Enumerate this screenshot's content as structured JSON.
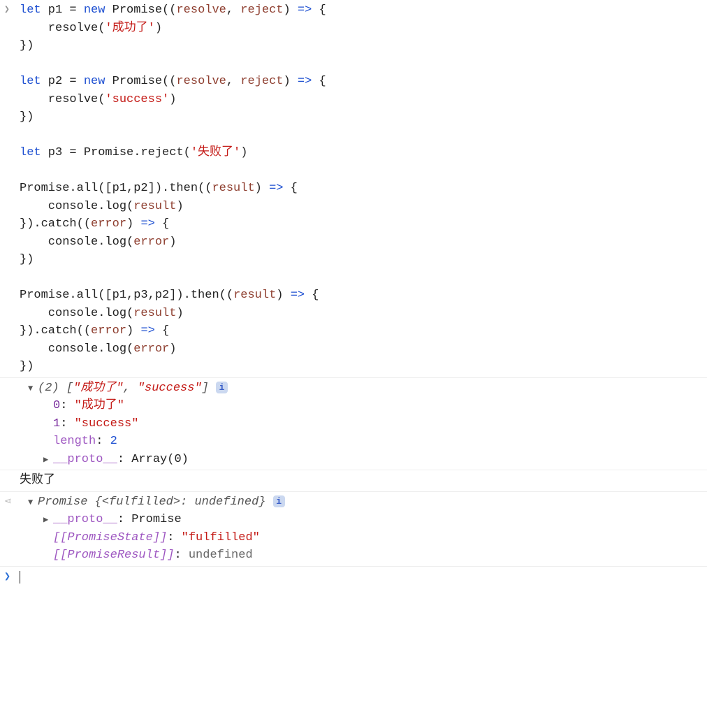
{
  "input_gutter": "❯",
  "return_gutter": "⋖",
  "prompt_gutter": "❯",
  "code": {
    "l1_let": "let",
    "l1_p1": " p1 ",
    "l1_eq": "= ",
    "l1_new": "new",
    "l1_prom": " Promise((",
    "l1_resolve": "resolve",
    "l1_c1": ", ",
    "l1_reject": "reject",
    "l1_c2": ") ",
    "l1_arrow": "=>",
    "l1_ob": " {",
    "l2_indent": "    resolve(",
    "l2_str": "'成功了'",
    "l2_close": ")",
    "l3": "})",
    "blank": "",
    "l5_let": "let",
    "l5_p2": " p2 ",
    "l5_eq": "= ",
    "l5_new": "new",
    "l5_prom": " Promise((",
    "l5_resolve": "resolve",
    "l5_c1": ", ",
    "l5_reject": "reject",
    "l5_c2": ") ",
    "l5_arrow": "=>",
    "l5_ob": " {",
    "l6_indent": "    resolve(",
    "l6_str": "'success'",
    "l6_close": ")",
    "l7": "})",
    "l9_let": "let",
    "l9_p3": " p3 ",
    "l9_eq": "= Promise.reject(",
    "l9_str": "'失败了'",
    "l9_close": ")",
    "l11_a": "Promise.all([p1,p2]).then((",
    "l11_result": "result",
    "l11_b": ") ",
    "l11_arrow": "=>",
    "l11_c": " {",
    "l12_a": "    console.log(",
    "l12_result": "result",
    "l12_b": ")",
    "l13_a": "}).catch((",
    "l13_error": "error",
    "l13_b": ") ",
    "l13_arrow": "=>",
    "l13_c": " {",
    "l14_a": "    console.log(",
    "l14_error": "error",
    "l14_b": ")",
    "l15": "})",
    "l17_a": "Promise.all([p1,p3,p2]).then((",
    "l17_result": "result",
    "l17_b": ") ",
    "l17_arrow": "=>",
    "l17_c": " {",
    "l18_a": "    console.log(",
    "l18_result": "result",
    "l18_b": ")",
    "l19_a": "}).catch((",
    "l19_error": "error",
    "l19_b": ") ",
    "l19_arrow": "=>",
    "l19_c": " {",
    "l20_a": "    console.log(",
    "l20_error": "error",
    "l20_b": ")",
    "l21": "})"
  },
  "output1": {
    "expand_down": "▼",
    "expand_right": "▶",
    "summary_count": "(2) ",
    "summary_open": "[",
    "summary_v0": "\"成功了\"",
    "summary_sep": ", ",
    "summary_v1": "\"success\"",
    "summary_close": "]",
    "info": "i",
    "idx0": "0",
    "idx0_sep": ": ",
    "val0": "\"成功了\"",
    "idx1": "1",
    "idx1_sep": ": ",
    "val1": "\"success\"",
    "length_label": "length",
    "length_sep": ": ",
    "length_val": "2",
    "proto_label": "__proto__",
    "proto_sep": ": ",
    "proto_val": "Array(0)"
  },
  "output2": {
    "text": "失败了"
  },
  "output3": {
    "expand_down": "▼",
    "expand_right": "▶",
    "summary_pre": "Promise ",
    "summary_open": "{",
    "summary_key": "<fulfilled>",
    "summary_sep": ": ",
    "summary_val": "undefined",
    "summary_close": "}",
    "info": "i",
    "proto_label": "__proto__",
    "proto_sep": ": ",
    "proto_val": "Promise",
    "state_label": "[[PromiseState]]",
    "state_sep": ": ",
    "state_val": "\"fulfilled\"",
    "result_label": "[[PromiseResult]]",
    "result_sep": ": ",
    "result_val": "undefined"
  }
}
